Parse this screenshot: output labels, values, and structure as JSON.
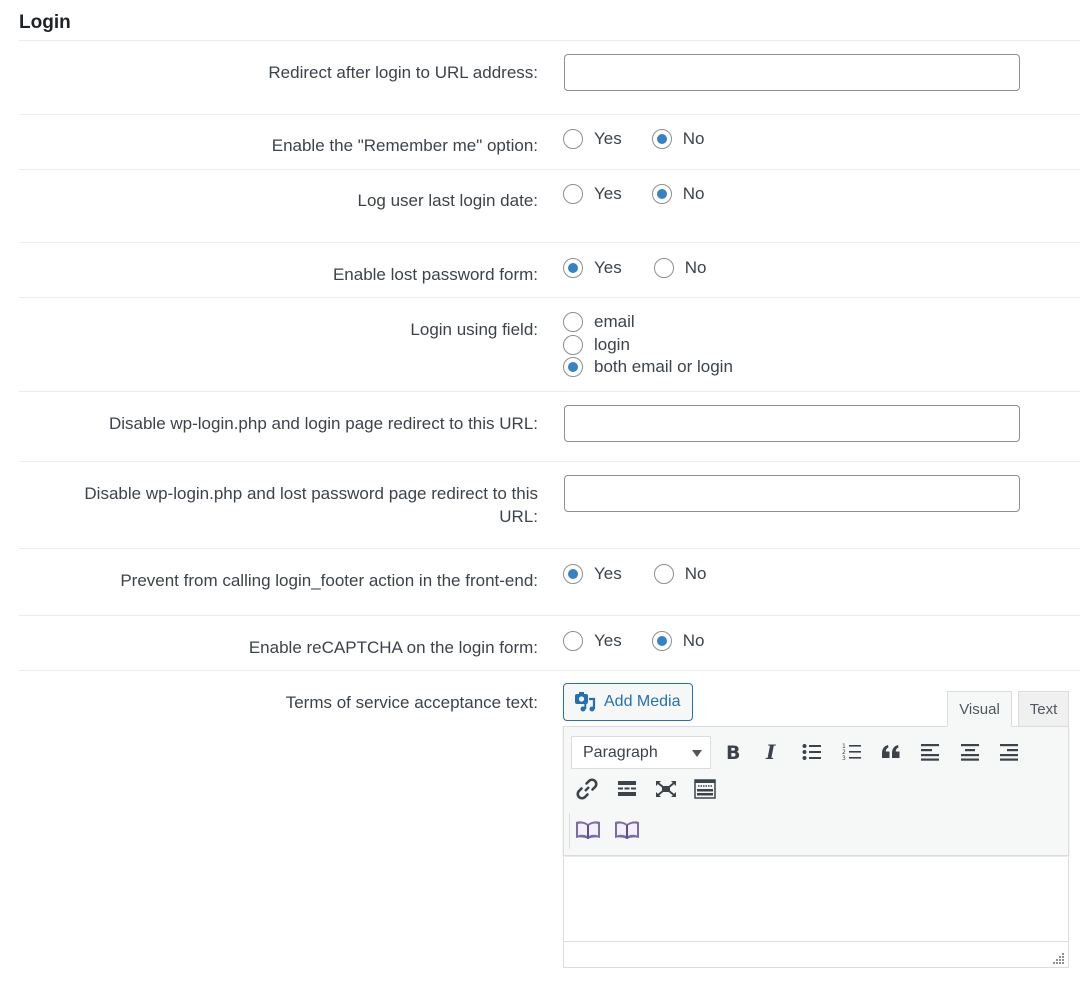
{
  "section": {
    "title": "Login"
  },
  "colors": {
    "accent": "#2271b1",
    "radio_checked": "#3582c4",
    "text": "#3c434a",
    "border": "#8c8f94"
  },
  "fields": {
    "redirect_after_login": {
      "label": "Redirect after login to URL address:",
      "value": "",
      "placeholder": ""
    },
    "remember_me": {
      "label": "Enable the \"Remember me\" option:",
      "options": [
        "Yes",
        "No"
      ],
      "selected": "No"
    },
    "log_last_login": {
      "label": "Log user last login date:",
      "options": [
        "Yes",
        "No"
      ],
      "selected": "No"
    },
    "lost_password_form": {
      "label": "Enable lost password form:",
      "options": [
        "Yes",
        "No"
      ],
      "selected": "Yes"
    },
    "login_using_field": {
      "label": "Login using field:",
      "options": [
        "email",
        "login",
        "both email or login"
      ],
      "selected": "both email or login"
    },
    "disable_wp_login_redirect": {
      "label": "Disable wp-login.php and login page redirect to this URL:",
      "value": ""
    },
    "disable_lost_password_redirect": {
      "label": "Disable wp-login.php and lost password page redirect to this URL:",
      "value": ""
    },
    "prevent_login_footer": {
      "label": "Prevent from calling login_footer action in the front-end:",
      "options": [
        "Yes",
        "No"
      ],
      "selected": "Yes"
    },
    "recaptcha_login": {
      "label": "Enable reCAPTCHA on the login form:",
      "options": [
        "Yes",
        "No"
      ],
      "selected": "No"
    },
    "terms_of_service": {
      "label": "Terms of service acceptance text:"
    }
  },
  "editor": {
    "add_media_label": "Add Media",
    "tabs": [
      {
        "label": "Visual",
        "active": true
      },
      {
        "label": "Text",
        "active": false
      }
    ],
    "format_select": "Paragraph",
    "toolbar_icons": [
      "bold-icon",
      "italic-icon",
      "bullet-list-icon",
      "numbered-list-icon",
      "blockquote-icon",
      "align-left-icon",
      "align-center-icon",
      "align-right-icon",
      "link-icon",
      "read-more-icon",
      "fullscreen-icon",
      "toolbar-toggle-icon",
      "book-icon",
      "book-icon"
    ],
    "content": ""
  }
}
